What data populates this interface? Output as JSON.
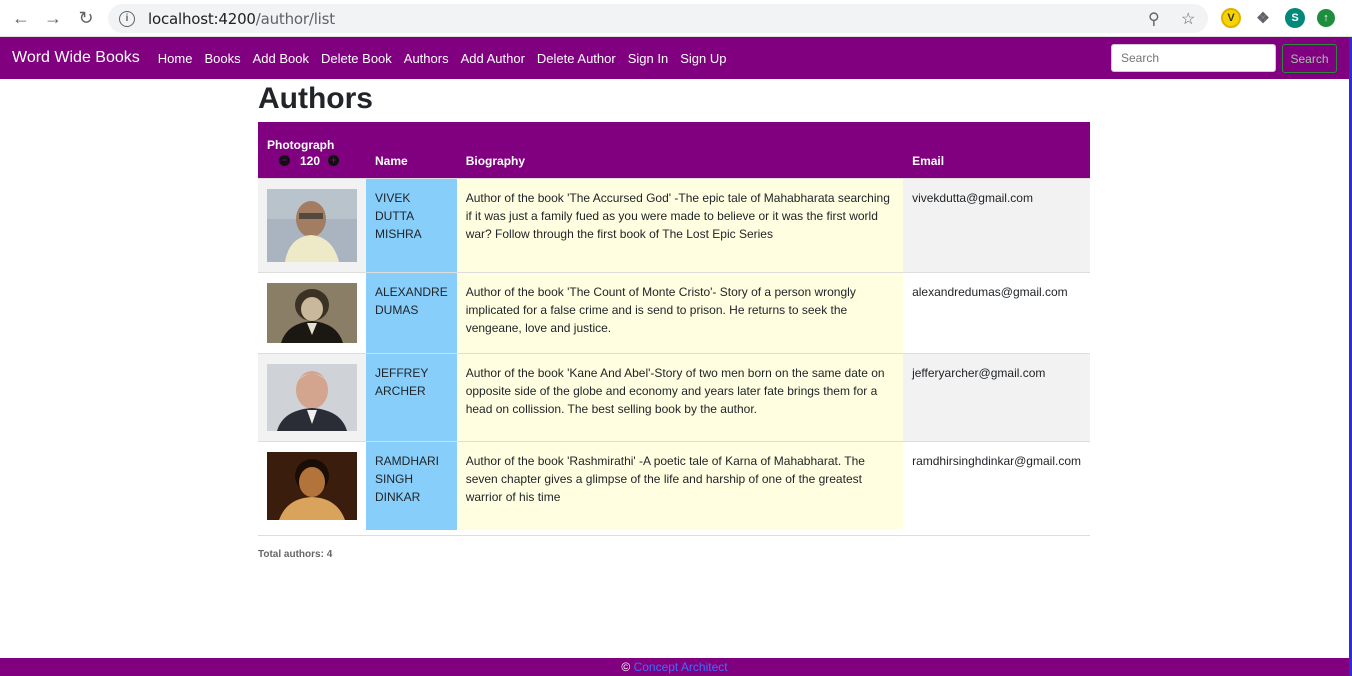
{
  "browser": {
    "url_host": "localhost:4200",
    "url_path": "/author/list",
    "profile_initial": "S"
  },
  "navbar": {
    "brand": "Word Wide Books",
    "links": [
      "Home",
      "Books",
      "Add Book",
      "Delete Book",
      "Authors",
      "Add Author",
      "Delete Author",
      "Sign In",
      "Sign Up"
    ],
    "search_placeholder": "Search",
    "search_button": "Search",
    "bg_color": "#800080"
  },
  "page": {
    "title": "Authors",
    "columns": {
      "photo": "Photograph",
      "photo_zoom": "120",
      "name": "Name",
      "bio": "Biography",
      "email": "Email"
    },
    "authors": [
      {
        "name": "VIVEK DUTTA MISHRA",
        "bio": "Author of the book 'The Accursed God' -The epic tale of Mahabharata searching if it was just a family fued as you were made to believe or it was the first world war? Follow through the first book of The Lost Epic Series",
        "email": "vivekdutta@gmail.com"
      },
      {
        "name": "ALEXANDRE DUMAS",
        "bio": "Author of the book 'The Count of Monte Cristo'- Story of a person wrongly implicated for a false crime and is send to prison. He returns to seek the vengeane, love and justice.",
        "email": "alexandredumas@gmail.com"
      },
      {
        "name": "JEFFREY ARCHER",
        "bio": "Author of the book 'Kane And Abel'-Story of two men born on the same date on opposite side of the globe and economy and years later fate brings them for a head on collission. The best selling book by the author.",
        "email": "jefferyarcher@gmail.com"
      },
      {
        "name": "RAMDHARI SINGH DINKAR",
        "bio": "Author of the book 'Rashmirathi' -A poetic tale of Karna of Mahabharat. The seven chapter gives a glimpse of the life and harship of one of the greatest warrior of his time",
        "email": "ramdhirsinghdinkar@gmail.com"
      }
    ],
    "total": "Total authors: 4"
  },
  "footer": {
    "copyright": "©",
    "link": "Concept Architect"
  }
}
